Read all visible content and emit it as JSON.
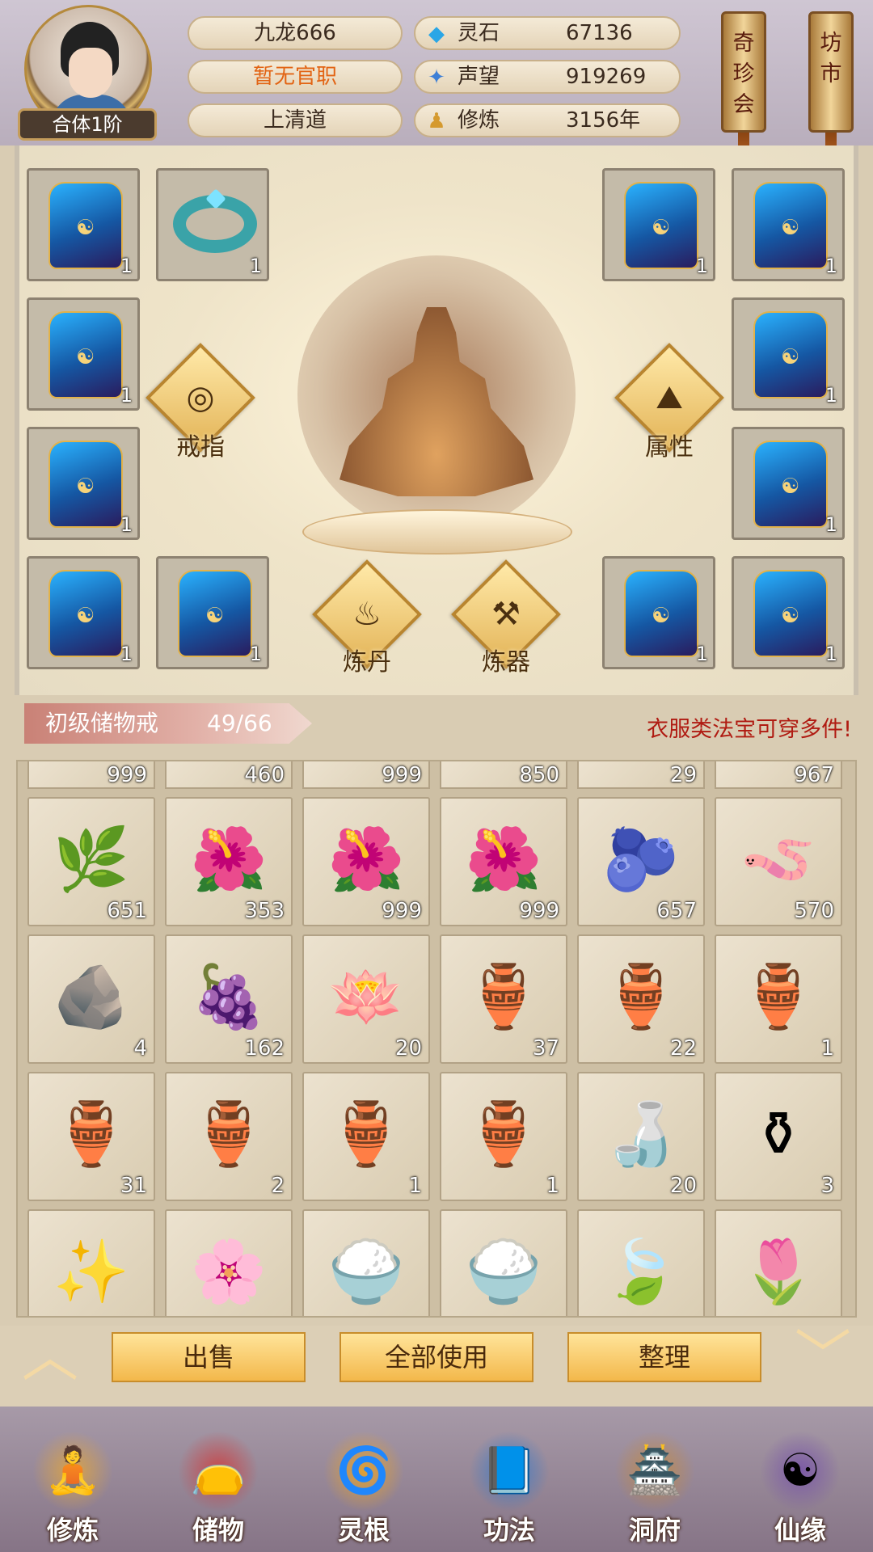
{
  "player": {
    "name": "九龙666",
    "official": "暂无官职",
    "sect": "上清道",
    "rank": "合体1阶"
  },
  "stats": [
    {
      "label": "灵石",
      "value": "67136",
      "icon": "spirit-stone-icon",
      "glyph": "◆",
      "color": "#2aa6e6"
    },
    {
      "label": "声望",
      "value": "919269",
      "icon": "reputation-icon",
      "glyph": "✦",
      "color": "#3d7fd6"
    },
    {
      "label": "修炼",
      "value": "3156年",
      "icon": "cultivation-icon",
      "glyph": "♟",
      "color": "#d59a2f"
    }
  ],
  "scrolls": {
    "left": "奇珍会",
    "right": "坊市"
  },
  "equipment": {
    "slot_counts": [
      "1",
      "1",
      "1",
      "1",
      "1",
      "1",
      "1",
      "1",
      "1",
      "1",
      "1",
      "1"
    ],
    "buttons": {
      "ring": "戒指",
      "attributes": "属性",
      "alchemy": "炼丹",
      "forging": "炼器"
    }
  },
  "storage": {
    "title": "初级储物戒",
    "capacity": "49/66",
    "tip": "衣服类法宝可穿多件!",
    "partial_row": [
      "999",
      "460",
      "999",
      "850",
      "29",
      "967"
    ],
    "rows": [
      [
        {
          "icon": "ginseng-icon",
          "glyph": "🌿",
          "count": "651"
        },
        {
          "icon": "herb-flower-icon",
          "glyph": "🌺",
          "count": "353"
        },
        {
          "icon": "herb-flower-icon",
          "glyph": "🌺",
          "count": "999"
        },
        {
          "icon": "herb-flower-icon",
          "glyph": "🌺",
          "count": "999"
        },
        {
          "icon": "fruit-branch-icon",
          "glyph": "🫐",
          "count": "657"
        },
        {
          "icon": "cordyceps-icon",
          "glyph": "🪱",
          "count": "570"
        }
      ],
      [
        {
          "icon": "ore-crystal-icon",
          "glyph": "🪨",
          "count": "4"
        },
        {
          "icon": "grape-vine-icon",
          "glyph": "🍇",
          "count": "162"
        },
        {
          "icon": "lotus-pod-icon",
          "glyph": "🪷",
          "count": "20"
        },
        {
          "icon": "treasure-gourd-icon",
          "glyph": "🏺",
          "count": "37"
        },
        {
          "icon": "treasure-gourd-icon",
          "glyph": "🏺",
          "count": "22"
        },
        {
          "icon": "treasure-gourd-icon",
          "glyph": "🏺",
          "count": "1"
        }
      ],
      [
        {
          "icon": "treasure-gourd-icon",
          "glyph": "🏺",
          "count": "31"
        },
        {
          "icon": "treasure-gourd-icon",
          "glyph": "🏺",
          "count": "2"
        },
        {
          "icon": "treasure-gourd-icon",
          "glyph": "🏺",
          "count": "1"
        },
        {
          "icon": "treasure-gourd-icon",
          "glyph": "🏺",
          "count": "1"
        },
        {
          "icon": "wine-gourd-icon",
          "glyph": "🍶",
          "count": "20"
        },
        {
          "icon": "jade-vase-icon",
          "glyph": "⚱",
          "count": "3"
        }
      ],
      [
        {
          "icon": "star-chart-icon",
          "glyph": "✨",
          "count": ""
        },
        {
          "icon": "pink-lotus-icon",
          "glyph": "🌸",
          "count": ""
        },
        {
          "icon": "rice-tray-icon",
          "glyph": "🍚",
          "count": ""
        },
        {
          "icon": "rice-tray-icon",
          "glyph": "🍚",
          "count": ""
        },
        {
          "icon": "teal-seeds-icon",
          "glyph": "🍃",
          "count": ""
        },
        {
          "icon": "red-lotus-icon",
          "glyph": "🌷",
          "count": ""
        }
      ]
    ]
  },
  "actions": {
    "sell": "出售",
    "use_all": "全部使用",
    "sort": "整理"
  },
  "nav": [
    {
      "label": "修炼",
      "icon": "cultivate-monk-icon",
      "glyph": "🧘"
    },
    {
      "label": "储物",
      "icon": "storage-bag-icon",
      "glyph": "👝"
    },
    {
      "label": "灵根",
      "icon": "spirit-root-icon",
      "glyph": "🌀"
    },
    {
      "label": "功法",
      "icon": "technique-book-icon",
      "glyph": "📘"
    },
    {
      "label": "洞府",
      "icon": "cave-dwelling-icon",
      "glyph": "🏯"
    },
    {
      "label": "仙缘",
      "icon": "fate-gourd-icon",
      "glyph": "☯"
    }
  ]
}
